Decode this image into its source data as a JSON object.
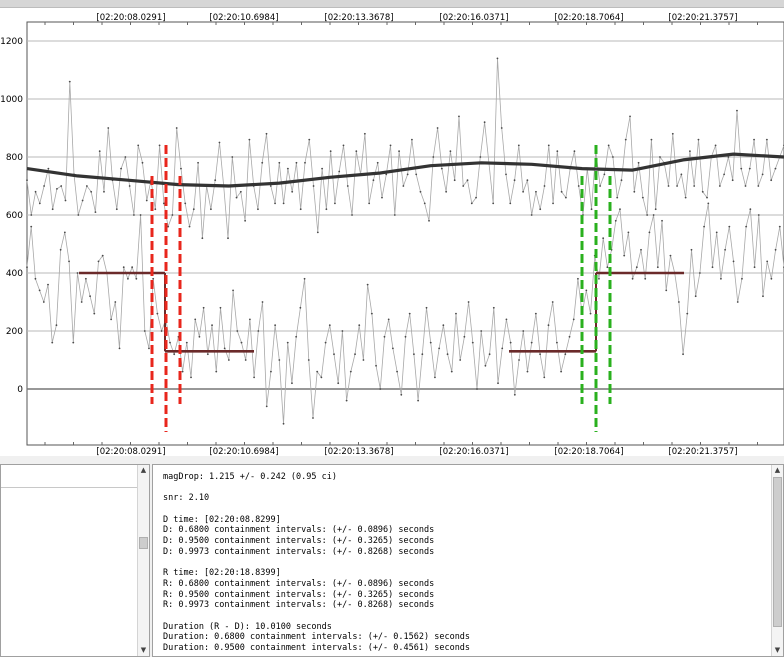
{
  "time_axis": {
    "labels": [
      "[02:20:08.0291]",
      "[02:20:10.6984]",
      "[02:20:13.3678]",
      "[02:20:16.0371]",
      "[02:20:18.7064]",
      "[02:20:21.3757]"
    ]
  },
  "chart_data": {
    "type": "line",
    "y_ticks": [
      0,
      200,
      400,
      600,
      800,
      1000,
      1200
    ],
    "ylim": [
      -140,
      1200
    ],
    "x_tick_labels": [
      "[02:20:08.0291]",
      "[02:20:10.6984]",
      "[02:20:13.3678]",
      "[02:20:16.0371]",
      "[02:20:18.7064]",
      "[02:20:21.3757]"
    ],
    "grid": true,
    "series": [
      {
        "role": "upper light curve (reference)",
        "color": "#a8a8a8",
        "values": [
          720,
          600,
          680,
          640,
          700,
          760,
          620,
          690,
          700,
          650,
          1060,
          740,
          600,
          650,
          700,
          680,
          610,
          820,
          680,
          900,
          720,
          620,
          760,
          800,
          700,
          600,
          840,
          780,
          650,
          720,
          620,
          840,
          640,
          560,
          600,
          900,
          760,
          640,
          560,
          620,
          780,
          520,
          700,
          620,
          720,
          850,
          700,
          520,
          800,
          660,
          680,
          580,
          860,
          700,
          620,
          780,
          880,
          700,
          640,
          780,
          640,
          760,
          680,
          780,
          620,
          780,
          860,
          700,
          540,
          760,
          620,
          820,
          640,
          750,
          840,
          700,
          600,
          820,
          740,
          880,
          640,
          720,
          780,
          660,
          740,
          840,
          600,
          820,
          700,
          740,
          860,
          740,
          680,
          640,
          580,
          800,
          900,
          760,
          680,
          820,
          720,
          940,
          700,
          720,
          640,
          660,
          800,
          920,
          780,
          640,
          1140,
          900,
          740,
          640,
          720,
          840,
          680,
          720,
          600,
          680,
          620,
          700,
          840,
          640,
          820,
          680,
          660,
          760,
          820,
          700,
          600,
          760,
          620,
          820,
          700,
          740,
          840,
          800,
          660,
          720,
          860,
          940,
          680,
          780,
          660,
          600,
          860,
          620,
          800,
          780,
          700,
          880,
          700,
          740,
          660,
          820,
          700,
          860,
          680,
          660,
          800,
          840,
          700,
          740,
          800,
          720,
          960,
          760,
          700,
          760,
          860,
          700,
          740,
          860,
          720,
          760,
          800,
          840
        ]
      },
      {
        "role": "smoothed upper light curve",
        "color": "#333333",
        "values": [
          760,
          735,
          720,
          705,
          700,
          710,
          730,
          745,
          770,
          780,
          775,
          760,
          755,
          790,
          810,
          800
        ]
      },
      {
        "role": "target light curve",
        "color": "#a8a8a8",
        "values": [
          420,
          560,
          380,
          340,
          300,
          360,
          160,
          220,
          480,
          540,
          440,
          160,
          400,
          300,
          380,
          320,
          260,
          440,
          460,
          400,
          240,
          300,
          140,
          420,
          380,
          420,
          380,
          600,
          200,
          140,
          380,
          260,
          200,
          240,
          160,
          120,
          180,
          60,
          160,
          40,
          240,
          180,
          280,
          120,
          220,
          60,
          280,
          140,
          100,
          340,
          200,
          160,
          100,
          240,
          40,
          200,
          300,
          -60,
          60,
          220,
          100,
          -120,
          160,
          20,
          180,
          280,
          380,
          100,
          -100,
          60,
          40,
          160,
          220,
          120,
          20,
          200,
          -40,
          60,
          120,
          220,
          100,
          360,
          260,
          80,
          0,
          180,
          240,
          140,
          60,
          -20,
          180,
          260,
          120,
          -40,
          120,
          280,
          160,
          40,
          140,
          220,
          120,
          60,
          260,
          100,
          180,
          300,
          160,
          0,
          200,
          80,
          120,
          280,
          20,
          140,
          240,
          160,
          -20,
          100,
          200,
          60,
          160,
          260,
          120,
          40,
          220,
          300,
          160,
          60,
          120,
          180,
          240,
          380,
          260,
          340,
          260,
          460,
          380,
          520,
          420,
          480,
          580,
          620,
          460,
          540,
          380,
          420,
          480,
          380,
          540,
          600,
          420,
          580,
          340,
          460,
          400,
          300,
          120,
          260,
          480,
          320,
          400,
          560,
          640,
          420,
          540,
          380,
          480,
          560,
          440,
          300,
          380,
          560,
          620,
          420,
          600,
          320,
          440,
          380,
          480,
          560,
          420
        ]
      }
    ],
    "step_levels": [
      {
        "segment": "before D",
        "value": 400,
        "color": "#6b2a2a"
      },
      {
        "segment": "after D",
        "value": 130,
        "color": "#6b2a2a"
      },
      {
        "segment": "before R",
        "value": 130,
        "color": "#6b2a2a"
      },
      {
        "segment": "after R",
        "value": 400,
        "color": "#6b2a2a"
      }
    ],
    "markers": [
      {
        "event": "D",
        "color": "#e8261c"
      },
      {
        "event": "R",
        "color": "#2ab01e"
      }
    ]
  },
  "colors": {
    "d_marker": "#e8261c",
    "r_marker": "#2ab01e",
    "step_line": "#6b2a2a",
    "smooth_line": "#333333",
    "raw_line": "#a8a8a8",
    "grid_line": "#b8b8b8"
  },
  "log": {
    "lines": [
      "magDrop: 1.215 +/- 0.242 (0.95 ci)",
      "",
      "snr: 2.10",
      "",
      "D time: [02:20:08.8299]",
      "D: 0.6800 containment intervals: (+/- 0.0896) seconds",
      "D: 0.9500 containment intervals: (+/- 0.3265) seconds",
      "D: 0.9973 containment intervals: (+/- 0.8268) seconds",
      "",
      "R time: [02:20:18.8399]",
      "R: 0.6800 containment intervals: (+/- 0.0896) seconds",
      "R: 0.9500 containment intervals: (+/- 0.3265) seconds",
      "R: 0.9973 containment intervals: (+/- 0.8268) seconds",
      "",
      "Duration (R - D): 10.0100 seconds",
      "Duration: 0.6800 containment intervals: (+/- 0.1562) seconds",
      "Duration: 0.9500 containment intervals: (+/- 0.4561) seconds"
    ]
  }
}
